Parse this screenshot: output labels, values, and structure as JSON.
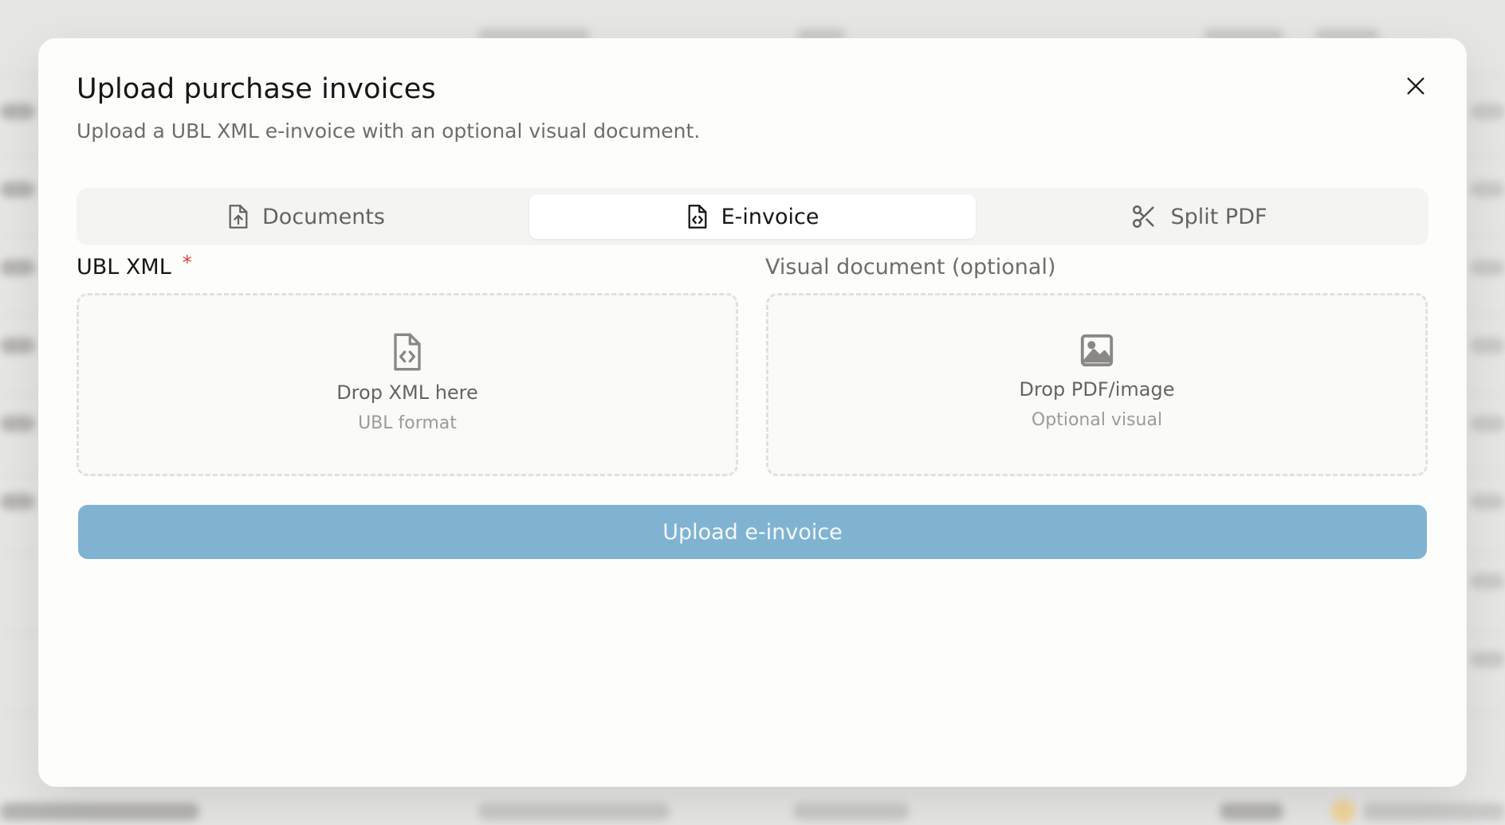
{
  "modal": {
    "title": "Upload purchase invoices",
    "description": "Upload a UBL XML e-invoice with an optional visual document."
  },
  "tabs": [
    {
      "label": "Documents",
      "icon": "file-upload-icon",
      "active": false
    },
    {
      "label": "E-invoice",
      "icon": "file-code-icon",
      "active": true
    },
    {
      "label": "Split PDF",
      "icon": "scissors-icon",
      "active": false
    }
  ],
  "fields": {
    "xml": {
      "label": "UBL XML",
      "required_marker": "*",
      "drop_text": "Drop XML here",
      "hint": "UBL format",
      "icon": "file-code-icon"
    },
    "visual": {
      "label": "Visual document (optional)",
      "drop_text": "Drop PDF/image",
      "hint": "Optional visual",
      "icon": "image-icon"
    }
  },
  "upload_button": {
    "label": "Upload e-invoice",
    "color": "#80b3d1"
  },
  "colors": {
    "required": "#d9443c",
    "accent": "#80b3d1"
  }
}
